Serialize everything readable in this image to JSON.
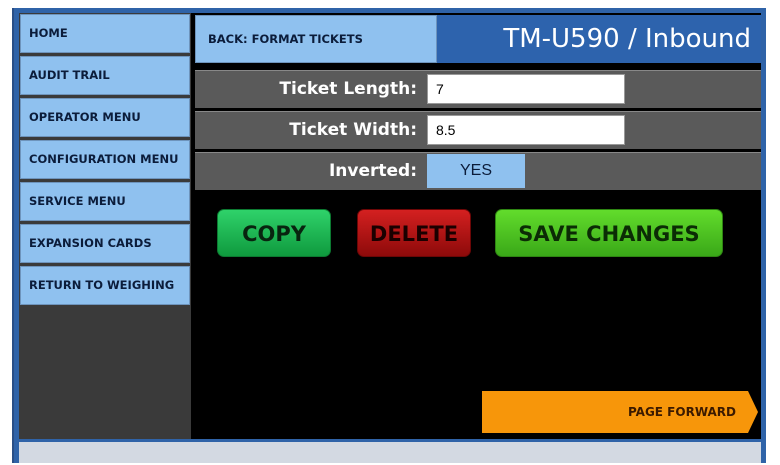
{
  "sidebar": {
    "items": [
      {
        "label": "HOME"
      },
      {
        "label": "AUDIT TRAIL"
      },
      {
        "label": "OPERATOR MENU"
      },
      {
        "label": "CONFIGURATION MENU"
      },
      {
        "label": "SERVICE MENU"
      },
      {
        "label": "EXPANSION CARDS"
      },
      {
        "label": "RETURN TO WEIGHING"
      }
    ]
  },
  "header": {
    "back_label": "BACK: FORMAT TICKETS",
    "title": "TM-U590 / Inbound"
  },
  "fields": {
    "ticket_length": {
      "label": "Ticket Length:",
      "value": "7"
    },
    "ticket_width": {
      "label": "Ticket Width:",
      "value": "8.5"
    },
    "inverted": {
      "label": "Inverted:",
      "value": "YES"
    }
  },
  "actions": {
    "copy": "COPY",
    "delete": "DELETE",
    "save": "SAVE CHANGES",
    "page_forward": "PAGE FORWARD"
  },
  "colors": {
    "nav_bg": "#8fc1ef",
    "title_bg": "#2d63ad",
    "copy": "#1fb552",
    "delete": "#b51616",
    "save": "#4fc223",
    "page_forward": "#f7960a"
  }
}
